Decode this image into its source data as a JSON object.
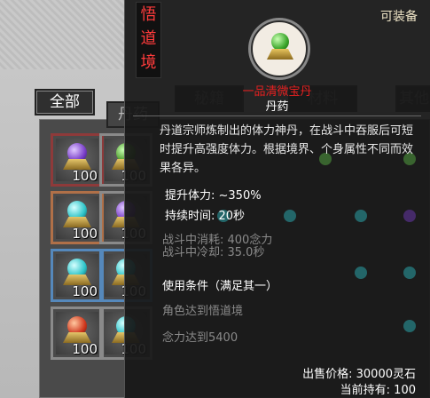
{
  "tabs": {
    "all_label": "全部",
    "dan_label": "丹药",
    "ghost1": "秘籍",
    "ghost2": "材料",
    "ghost3": "其他"
  },
  "inventory": {
    "slots": [
      {
        "count": "100",
        "gem_color": "#7a3fc9",
        "frame": "purple"
      },
      {
        "count": "100",
        "gem_color": "#4c9a2a",
        "frame": "gray"
      },
      {
        "count": "100",
        "gem_color": "#2ec4c9",
        "frame": "orange"
      },
      {
        "count": "100",
        "gem_color": "#7a3fc9",
        "frame": "gray"
      },
      {
        "count": "100",
        "gem_color": "#2ec4c9",
        "frame": "blue"
      },
      {
        "count": "100",
        "gem_color": "#2ec4c9",
        "frame": "blue"
      },
      {
        "count": "100",
        "gem_color": "#d0381e",
        "frame": "gray"
      },
      {
        "count": "100",
        "gem_color": "#2ec4c9",
        "frame": "gray"
      }
    ]
  },
  "tooltip": {
    "realm_chars": [
      "悟",
      "道",
      "境"
    ],
    "equip_label": "可装备",
    "item_name": "一品清微宝丹",
    "item_type": "丹药",
    "description": "丹道宗师炼制出的体力神丹，在战斗中吞服后可短时提升高强度体力。根据境界、个身属性不同而效果各异。",
    "stat1": "提升体力: ~350%",
    "stat2": "持续时间: 20秒",
    "combat_cost": "战斗中消耗: 400念力",
    "combat_cd": "战斗中冷却: 35.0秒",
    "condition_title": "使用条件（满足其一）",
    "condition1": "角色达到悟道境",
    "condition2": "念力达到5400",
    "price": "出售价格: 30000灵石",
    "owned": "当前持有: 100"
  },
  "colors": {
    "name_red": "#e62020",
    "realm_red": "#ff3b3b",
    "dim_text": "#8a8a8a"
  }
}
